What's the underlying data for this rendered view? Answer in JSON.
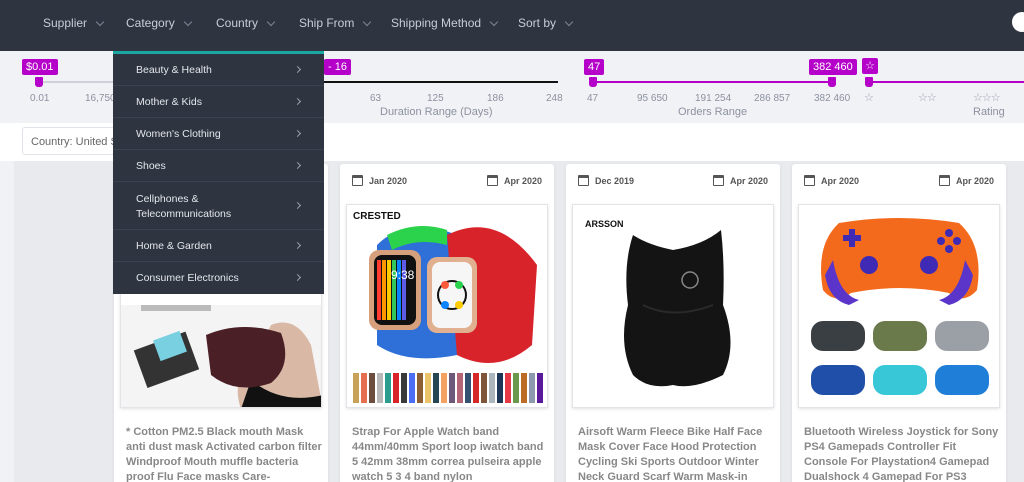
{
  "nav": {
    "items": [
      "Supplier",
      "Category",
      "Country",
      "Ship From",
      "Shipping Method",
      "Sort by"
    ]
  },
  "filters": {
    "price": {
      "min_badge": "$0.01",
      "ticks": [
        "0.01",
        "16,750"
      ]
    },
    "duration": {
      "badge_partial": "- 16",
      "ticks": [
        "63",
        "125",
        "186",
        "248"
      ],
      "label": "Duration Range (Days)"
    },
    "orders": {
      "min_badge": "47",
      "max_badge": "382 460",
      "ticks": [
        "47",
        "95 650",
        "191 254",
        "286 857",
        "382 460"
      ],
      "label": "Orders Range"
    },
    "rating": {
      "label": "Rating",
      "stars": [
        "☆",
        "☆☆",
        "☆☆☆"
      ]
    }
  },
  "country_select": {
    "value": "Country: United St"
  },
  "category_menu": [
    {
      "label": "Beauty & Health"
    },
    {
      "label": "Mother & Kids"
    },
    {
      "label": "Women's Clothing"
    },
    {
      "label": "Shoes"
    },
    {
      "label": "Cellphones &",
      "label2": "Telecommunications"
    },
    {
      "label": "Home & Garden"
    },
    {
      "label": "Consumer Electronics"
    }
  ],
  "products": [
    {
      "date_from": "",
      "date_to": "",
      "title": "* Cotton PM2.5 Black mouth Mask anti dust mask Activated carbon filter Windproof Mouth muffle bacteria proof Flu Face masks Care-"
    },
    {
      "date_from": "Jan 2020",
      "date_to": "Apr 2020",
      "brand": "CRESTED",
      "title": "Strap For Apple Watch band 44mm/40mm Sport loop iwatch band 5 42mm 38mm correa pulseira apple watch 5 3 4 band nylon"
    },
    {
      "date_from": "Dec 2019",
      "date_to": "Apr 2020",
      "brand": "ARSSON",
      "title": "Airsoft Warm Fleece Bike Half Face Mask Cover Face Hood Protection Cycling Ski Sports Outdoor Winter Neck Guard Scarf Warm Mask-in"
    },
    {
      "date_from": "Apr 2020",
      "date_to": "Apr 2020",
      "title": "Bluetooth Wireless Joystick for Sony PS4 Gamepads Controller Fit Console For Playstation4 Gamepad Dualshock 4 Gamepad For PS3"
    }
  ],
  "colors": {
    "accent": "#b400c8",
    "nav_bg": "#2e3440",
    "menu_accent": "#1aa7a3"
  }
}
